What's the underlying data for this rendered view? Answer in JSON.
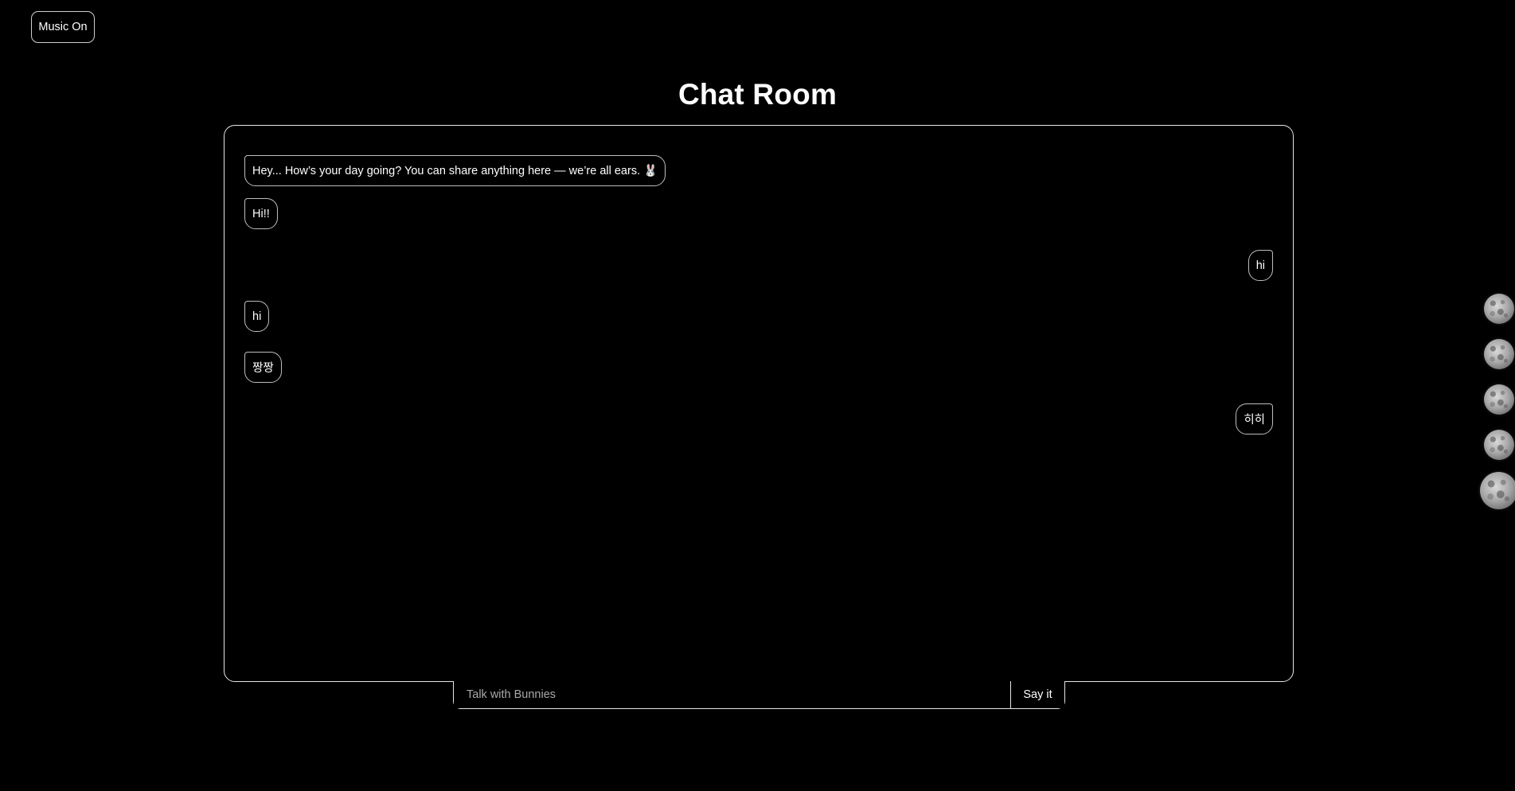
{
  "music_button": {
    "label": "Music On"
  },
  "header": {
    "title": "Chat Room"
  },
  "messages": [
    {
      "side": "left",
      "text": "Hey... How’s your day going? You can share anything here — we’re all ears. 🐰"
    },
    {
      "side": "left",
      "text": "Hi!!"
    },
    {
      "side": "right",
      "text": "hi"
    },
    {
      "side": "left",
      "text": "hi"
    },
    {
      "side": "left",
      "text": "짱짱"
    },
    {
      "side": "right",
      "text": "히히"
    }
  ],
  "composer": {
    "placeholder": "Talk with Bunnies",
    "value": "",
    "send_label": "Say it"
  },
  "moon_nav": {
    "icons": [
      "moon-icon",
      "moon-icon",
      "moon-icon",
      "moon-icon",
      "moon-icon"
    ],
    "active_index": 4
  },
  "colors": {
    "background": "#000000",
    "text": "#ffffff",
    "border": "#e6e6e6",
    "placeholder": "#a9a9a9"
  }
}
